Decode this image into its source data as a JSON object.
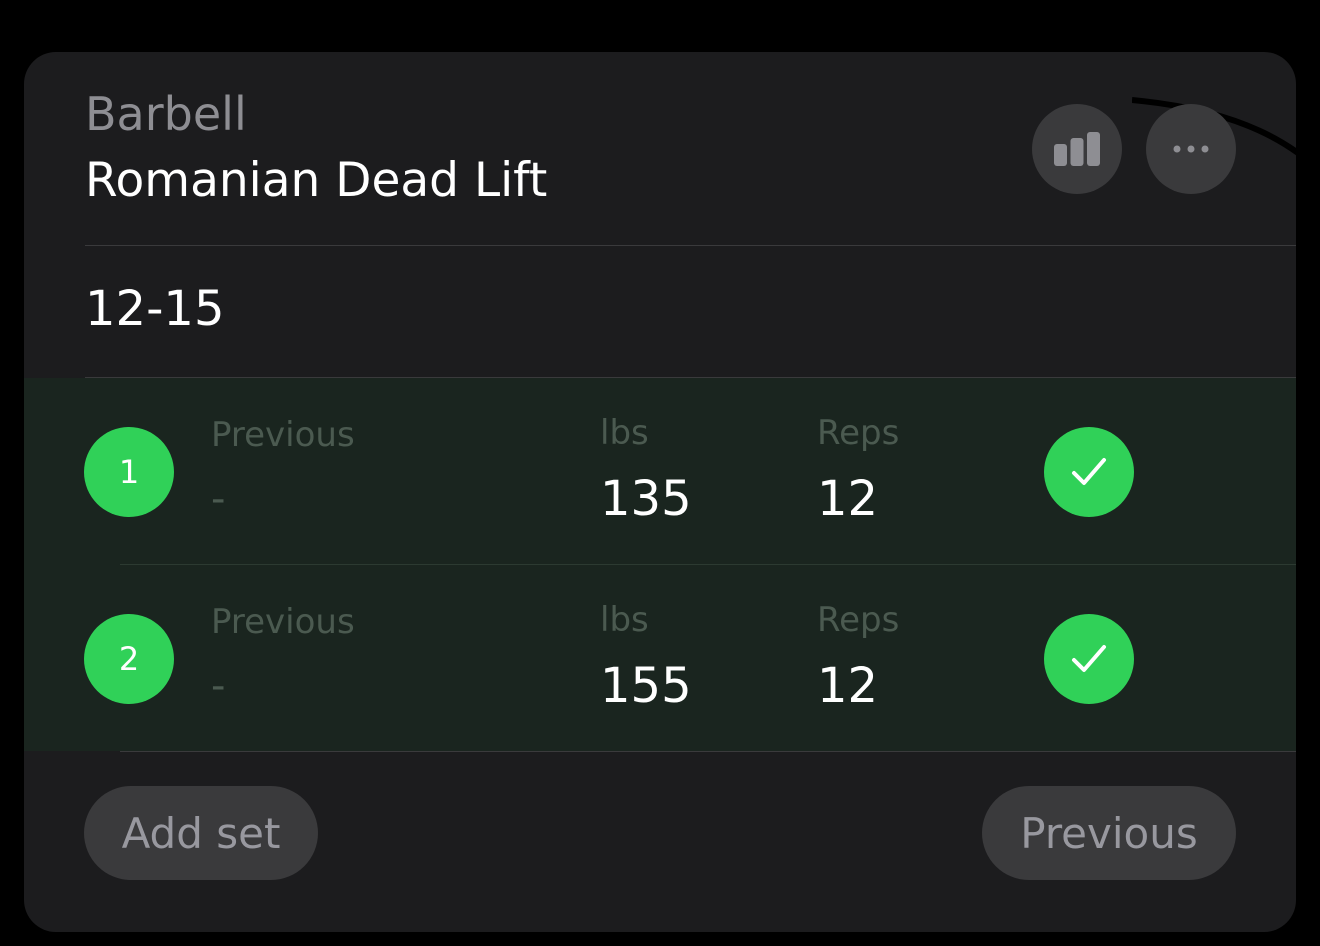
{
  "exercise": {
    "equipment": "Barbell",
    "name": "Romanian Dead Lift",
    "rep_range": "12-15"
  },
  "header_buttons": {
    "stats_icon": "bar-chart-icon",
    "more_icon": "ellipsis-icon"
  },
  "sets": [
    {
      "number": "1",
      "previous_label": "Previous",
      "previous_value": "-",
      "weight_label": "lbs",
      "weight": "135",
      "reps_label": "Reps",
      "reps": "12",
      "completed": true
    },
    {
      "number": "2",
      "previous_label": "Previous",
      "previous_value": "-",
      "weight_label": "lbs",
      "weight": "155",
      "reps_label": "Reps",
      "reps": "12",
      "completed": true
    }
  ],
  "footer": {
    "add_set_label": "Add set",
    "previous_label": "Previous"
  },
  "colors": {
    "background": "#000000",
    "card": "#1c1c1e",
    "completed_row": "#1a251f",
    "accent_green": "#30d158",
    "button_gray": "#3a3a3c",
    "muted_text": "#8e8e93"
  }
}
